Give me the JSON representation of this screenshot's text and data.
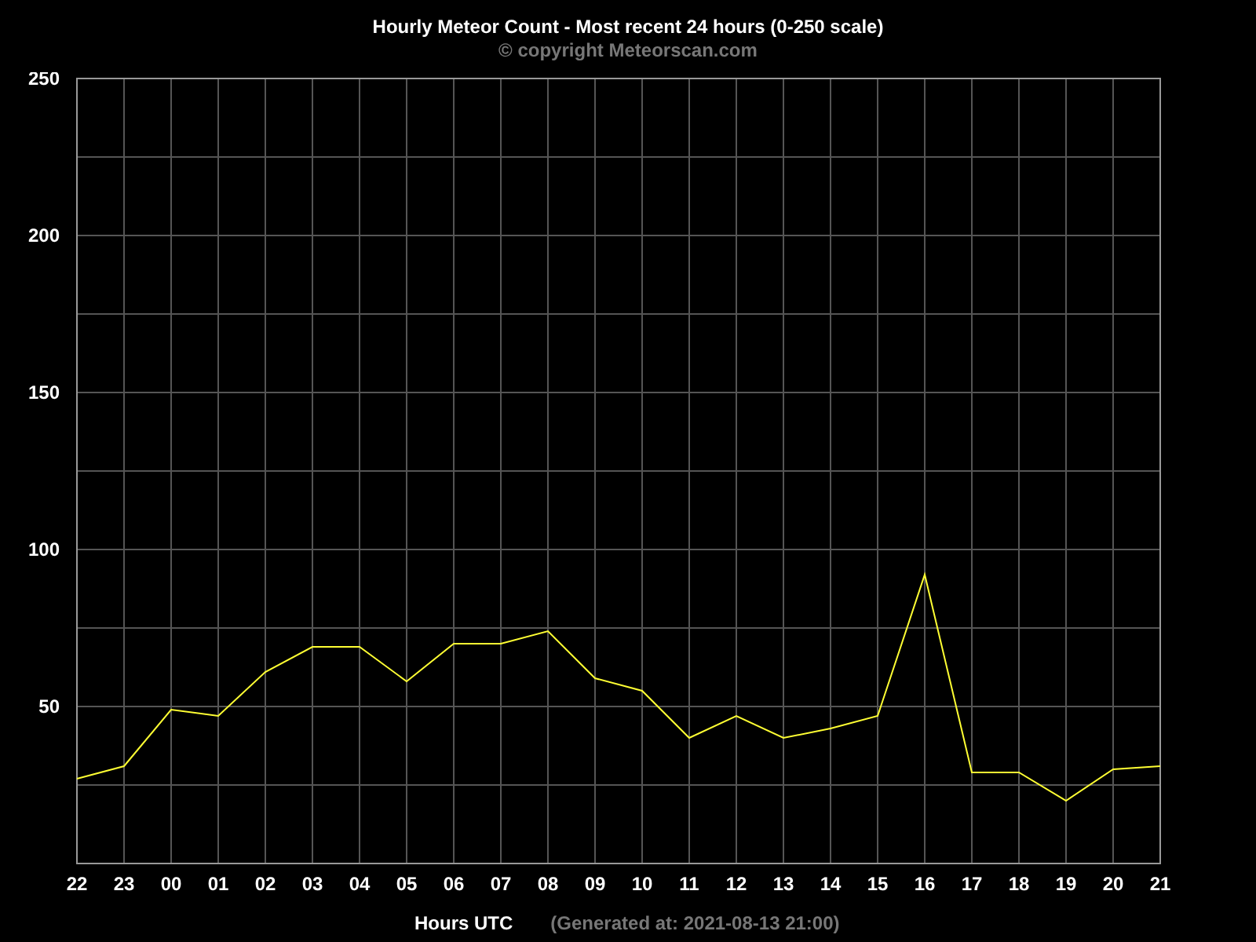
{
  "header": {
    "title": "Hourly Meteor Count - Most recent 24 hours (0-250 scale)",
    "copyright": "© copyright Meteorscan.com"
  },
  "chart": {
    "chart_data": {
      "type": "line",
      "xlabel": "Hours UTC",
      "categories": [
        "22",
        "23",
        "00",
        "01",
        "02",
        "03",
        "04",
        "05",
        "06",
        "07",
        "08",
        "09",
        "10",
        "11",
        "12",
        "13",
        "14",
        "15",
        "16",
        "17",
        "18",
        "19",
        "20",
        "21"
      ],
      "series": [
        {
          "color": "#ffff33",
          "values": [
            27,
            31,
            49,
            47,
            61,
            69,
            69,
            58,
            70,
            70,
            74,
            59,
            55,
            40,
            47,
            40,
            43,
            47,
            92,
            29,
            29,
            20,
            30,
            31
          ]
        }
      ],
      "ylim": [
        0,
        250
      ],
      "yticks": [
        50,
        100,
        150,
        200,
        250
      ],
      "grid": true
    },
    "generated": "(Generated at: 2021-08-13 21:00)"
  }
}
